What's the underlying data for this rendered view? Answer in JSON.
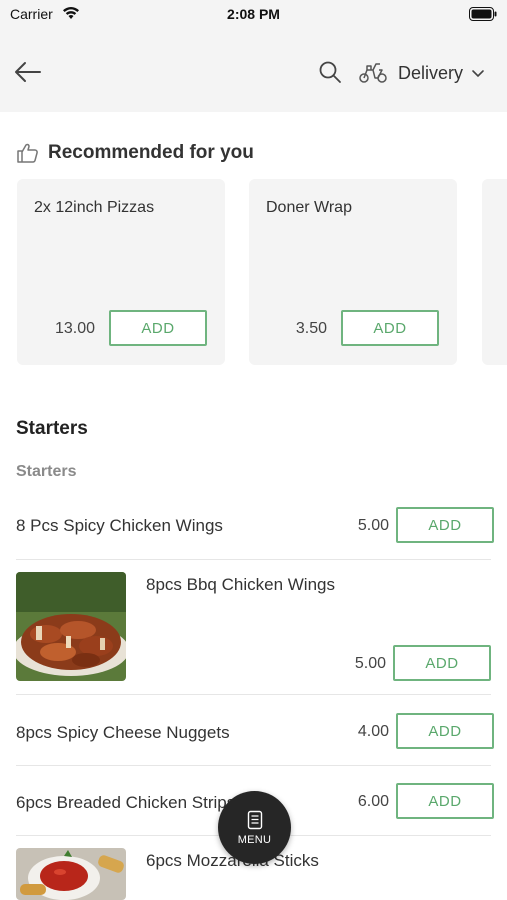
{
  "status_bar": {
    "carrier": "Carrier",
    "time": "2:08 PM"
  },
  "nav": {
    "delivery_label": "Delivery"
  },
  "recommended": {
    "title": "Recommended for you",
    "items": [
      {
        "name": "2x 12inch Pizzas",
        "price": "13.00",
        "add_label": "ADD"
      },
      {
        "name": "Doner Wrap",
        "price": "3.50",
        "add_label": "ADD"
      }
    ]
  },
  "category": {
    "title": "Starters",
    "subtitle": "Starters",
    "items": [
      {
        "name": "8 Pcs Spicy Chicken Wings",
        "price": "5.00",
        "add_label": "ADD"
      },
      {
        "name": "8pcs Bbq Chicken Wings",
        "price": "5.00",
        "add_label": "ADD"
      },
      {
        "name": "8pcs Spicy Cheese Nuggets",
        "price": "4.00",
        "add_label": "ADD"
      },
      {
        "name": "6pcs Breaded Chicken Strips",
        "price": "6.00",
        "add_label": "ADD"
      },
      {
        "name": "6pcs Mozzarella Sticks"
      }
    ]
  },
  "menu_fab": {
    "label": "MENU"
  },
  "colors": {
    "accent": "#5aa86c",
    "nav_bg": "#f4f4f4",
    "fab_bg": "#262626"
  }
}
